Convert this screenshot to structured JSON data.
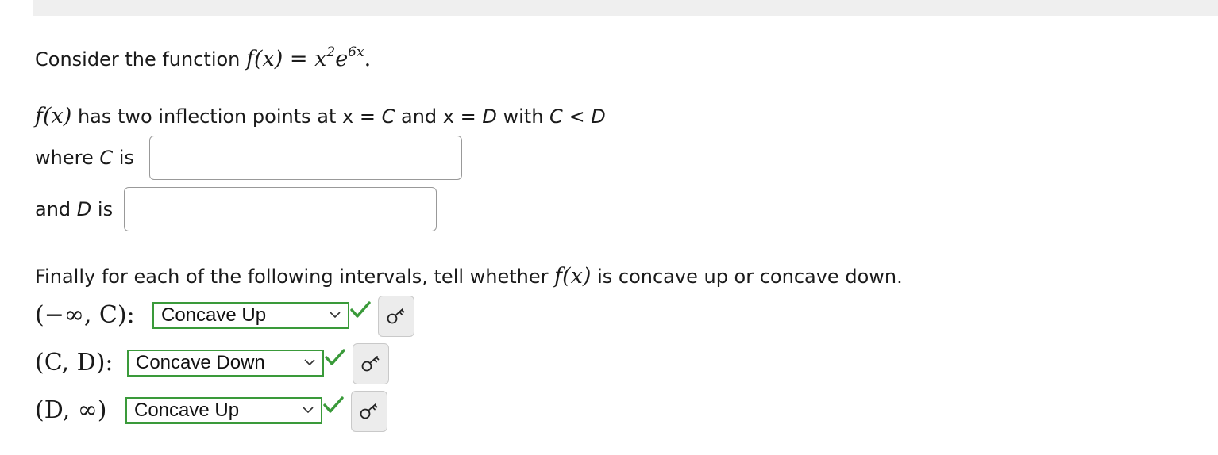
{
  "question": {
    "intro_text": "Consider the function",
    "function_lhs": "f(x)",
    "equals": "=",
    "function_base": "x",
    "function_exp1": "2",
    "function_e": "e",
    "function_exp2": "6x",
    "function_period": ".",
    "inflection_fx": "f(x)",
    "inflection_text": "has two inflection points at x =",
    "inflection_c": "C",
    "inflection_and": "and x =",
    "inflection_d": "D",
    "inflection_with": "with",
    "inflection_c2": "C",
    "inflection_lt": "<",
    "inflection_d2": "D"
  },
  "inputs": {
    "c_label_prefix": "where",
    "c_label_var": "C",
    "c_label_suffix": "is",
    "c_value": "",
    "d_label_prefix": "and",
    "d_label_var": "D",
    "d_label_suffix": "is",
    "d_value": ""
  },
  "concavity": {
    "prompt_prefix": "Finally for each of the following intervals, tell whether",
    "prompt_fx": "f(x)",
    "prompt_suffix": "is concave up or concave down.",
    "rows": [
      {
        "interval": "(−∞, C):",
        "selected": "Concave Up",
        "status": "correct"
      },
      {
        "interval": "(C, D):",
        "selected": "Concave Down",
        "status": "correct"
      },
      {
        "interval": "(D, ∞)",
        "selected": "Concave Up",
        "status": "correct"
      }
    ]
  },
  "colors": {
    "correct_green": "#3a9a3a",
    "key_button_bg": "#ececec"
  },
  "icons": {
    "dropdown": "chevron-down-icon",
    "status": "checkmark-icon",
    "help": "key-icon"
  }
}
